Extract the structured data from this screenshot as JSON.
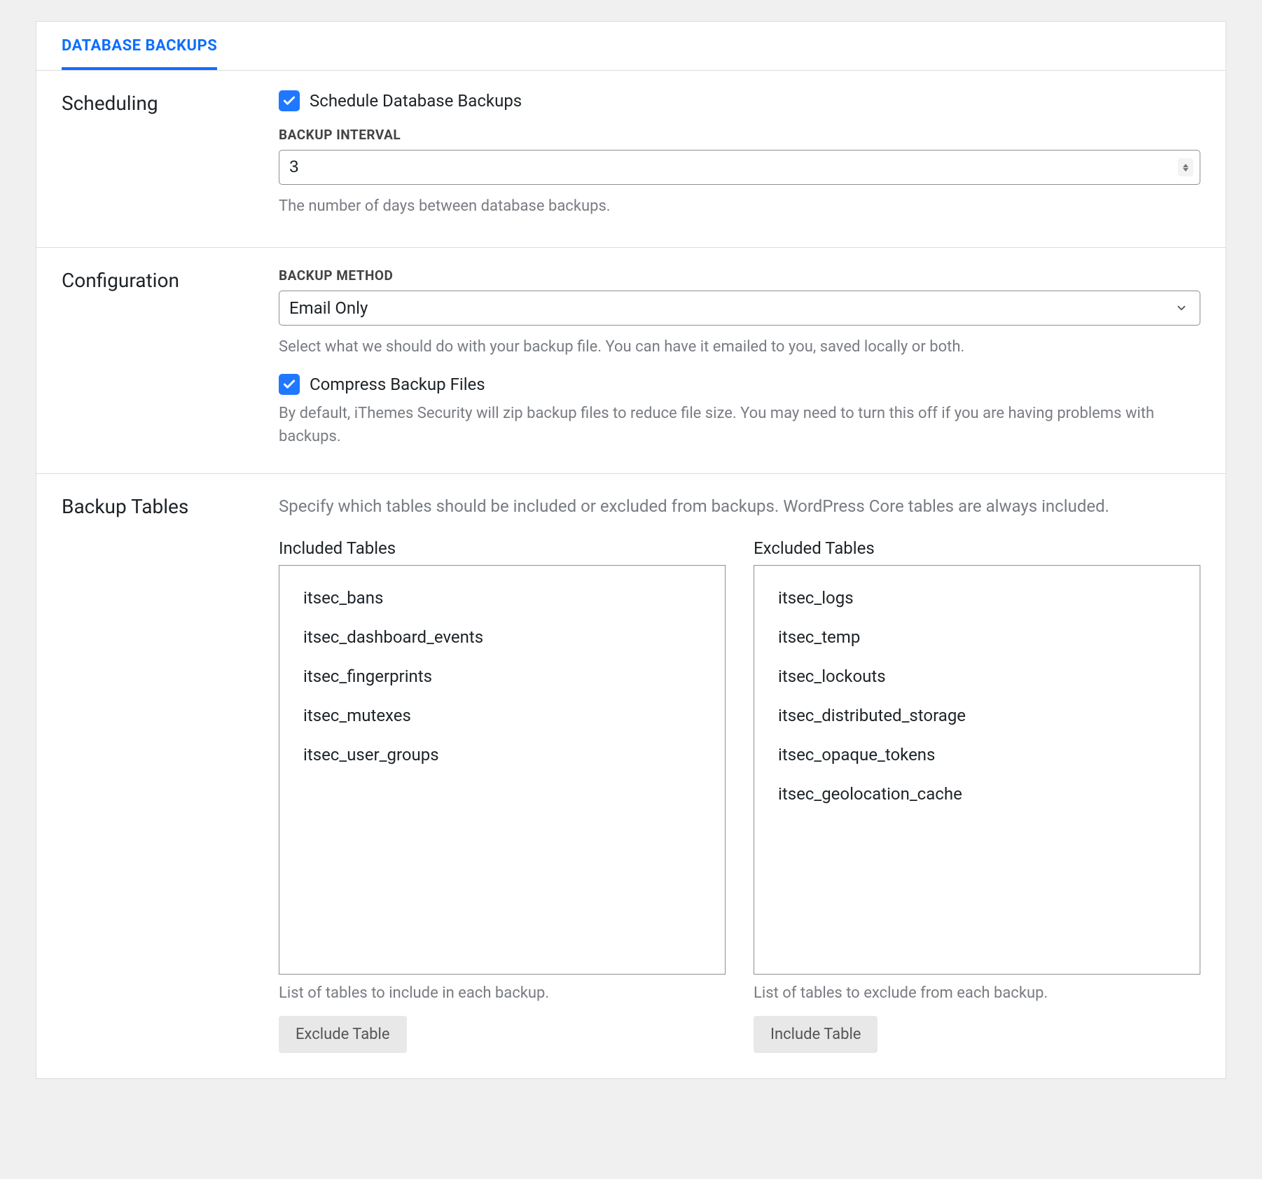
{
  "tab": {
    "label": "DATABASE BACKUPS"
  },
  "scheduling": {
    "heading": "Scheduling",
    "enable_label": "Schedule Database Backups",
    "interval_label": "BACKUP INTERVAL",
    "interval_value": "3",
    "interval_help": "The number of days between database backups."
  },
  "configuration": {
    "heading": "Configuration",
    "method_label": "BACKUP METHOD",
    "method_value": "Email Only",
    "method_help": "Select what we should do with your backup file. You can have it emailed to you, saved locally or both.",
    "compress_label": "Compress Backup Files",
    "compress_help": "By default, iThemes Security will zip backup files to reduce file size. You may need to turn this off if you are having problems with backups."
  },
  "backup_tables": {
    "heading": "Backup Tables",
    "intro": "Specify which tables should be included or excluded from backups. WordPress Core tables are always included.",
    "included_heading": "Included Tables",
    "excluded_heading": "Excluded Tables",
    "included": [
      "itsec_bans",
      "itsec_dashboard_events",
      "itsec_fingerprints",
      "itsec_mutexes",
      "itsec_user_groups"
    ],
    "excluded": [
      "itsec_logs",
      "itsec_temp",
      "itsec_lockouts",
      "itsec_distributed_storage",
      "itsec_opaque_tokens",
      "itsec_geolocation_cache"
    ],
    "included_help": "List of tables to include in each backup.",
    "excluded_help": "List of tables to exclude from each backup.",
    "exclude_btn": "Exclude Table",
    "include_btn": "Include Table"
  }
}
